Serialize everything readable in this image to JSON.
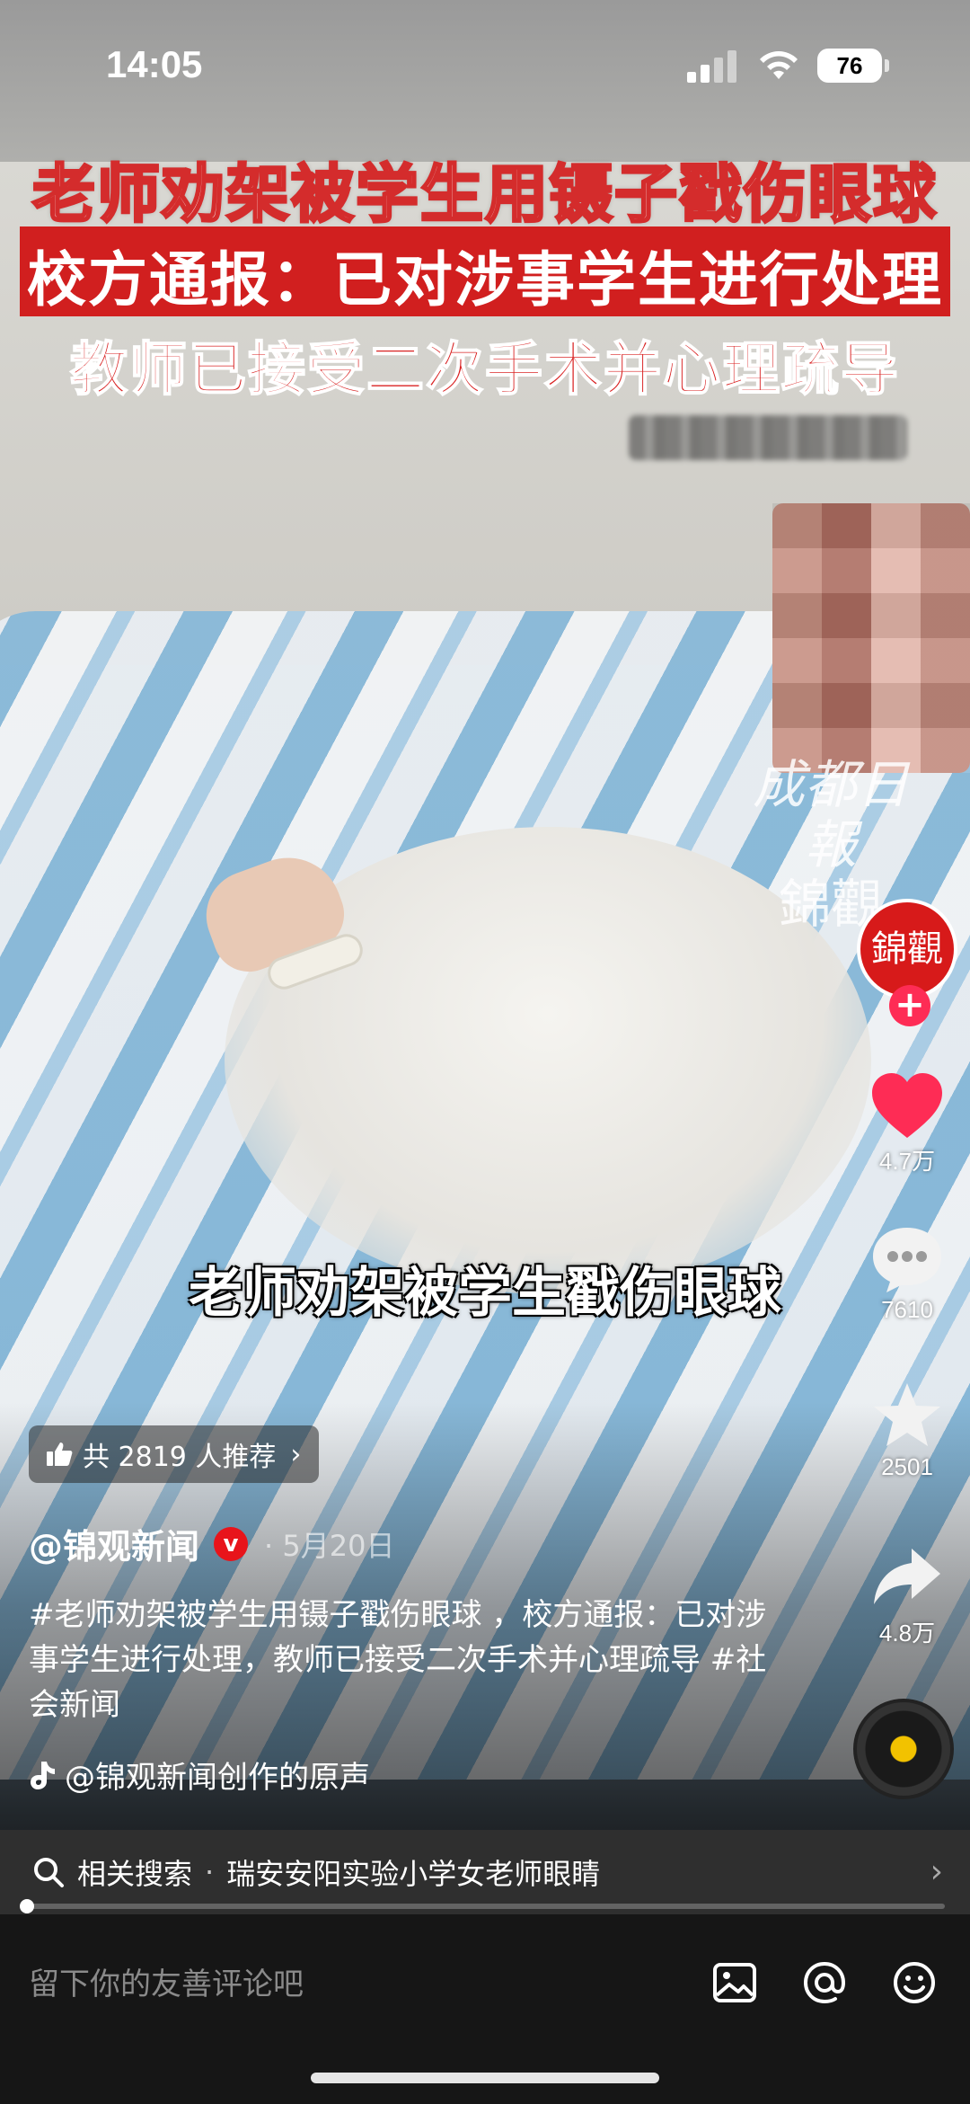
{
  "status_bar": {
    "time": "14:05",
    "battery": "76"
  },
  "headlines": {
    "line1": "老师劝架被学生用镊子戳伤眼球",
    "line2": "校方通报：已对涉事学生进行处理",
    "line3": "教师已接受二次手术并心理疏导"
  },
  "watermark": {
    "line1": "成都日報",
    "line2": "錦觀"
  },
  "subtitle": "老师劝架被学生戳伤眼球",
  "rail": {
    "avatar_text": "錦觀",
    "follow": "+",
    "likes": "4.7万",
    "comments": "7610",
    "favorites": "2501",
    "shares": "4.8万"
  },
  "recommend": {
    "label": "共 2819 人推荐",
    "chevron": "›"
  },
  "author": {
    "name": "@锦观新闻",
    "verified": "v",
    "date": "· 5月20日"
  },
  "description": "#老师劝架被学生用镊子戳伤眼球 ，校方通报：已对涉事学生进行处理，教师已接受二次手术并心理疏导 #社会新闻",
  "music": {
    "label": "@锦观新闻创作的原声"
  },
  "related_search": {
    "prefix": "相关搜索",
    "separator": "·",
    "query": "瑞安安阳实验小学女老师眼睛",
    "chevron": "›"
  },
  "progress": {
    "fraction": 0.0
  },
  "comment_bar": {
    "placeholder": "留下你的友善评论吧"
  },
  "colors": {
    "like": "#fe2c55",
    "headline_red": "#d11f1f",
    "verified": "#e8141b",
    "disc_center": "#f2c200"
  },
  "icons": [
    "like-icon",
    "thumbs-up-icon",
    "comment-icon",
    "star-icon",
    "share-icon",
    "search-icon",
    "image-icon",
    "at-icon",
    "emoji-icon",
    "music-note-icon"
  ]
}
